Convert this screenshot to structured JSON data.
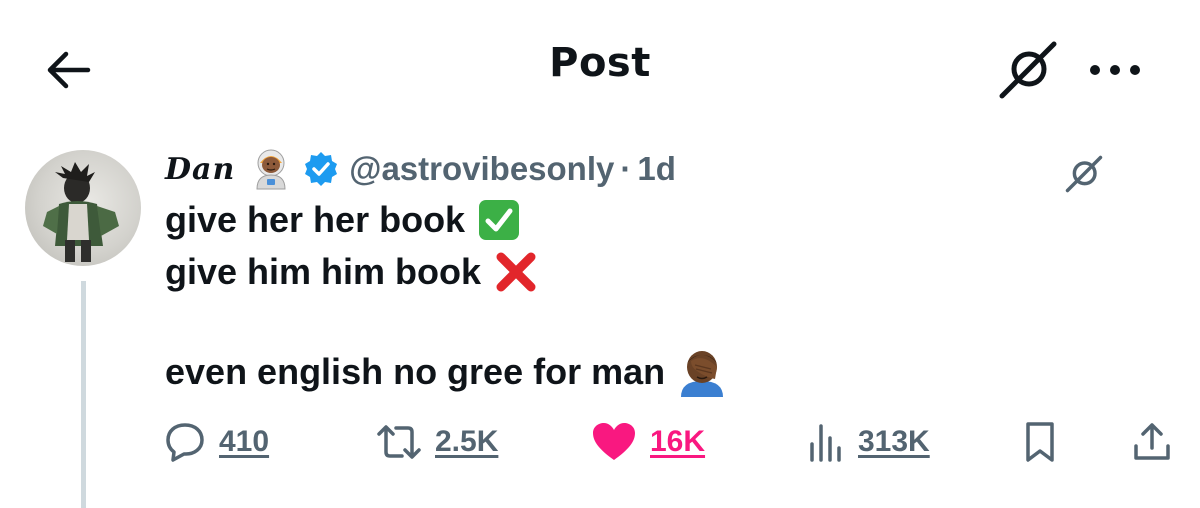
{
  "header": {
    "title": "Post",
    "back_icon": "arrow-left-icon",
    "grok_icon": "grok-icon",
    "more_icon": "more-horizontal-icon"
  },
  "post": {
    "author": {
      "display_name": "Dan",
      "name_emoji": "astronaut-emoji",
      "verified": true,
      "handle": "@astrovibesonly",
      "separator": "·",
      "time": "1d"
    },
    "lines": [
      "give her her book",
      "give him him book",
      "even english no gree for man"
    ],
    "emojis": [
      "check-mark-emoji",
      "cross-mark-emoji",
      "facepalm-emoji"
    ],
    "stats": {
      "replies": "410",
      "reposts": "2.5K",
      "likes": "16K",
      "views": "313K"
    },
    "liked": true
  },
  "colors": {
    "text": "#0f1419",
    "secondary": "#536471",
    "verified": "#1d9bf0",
    "like": "#f91880",
    "thread_line": "#cfd9de"
  }
}
